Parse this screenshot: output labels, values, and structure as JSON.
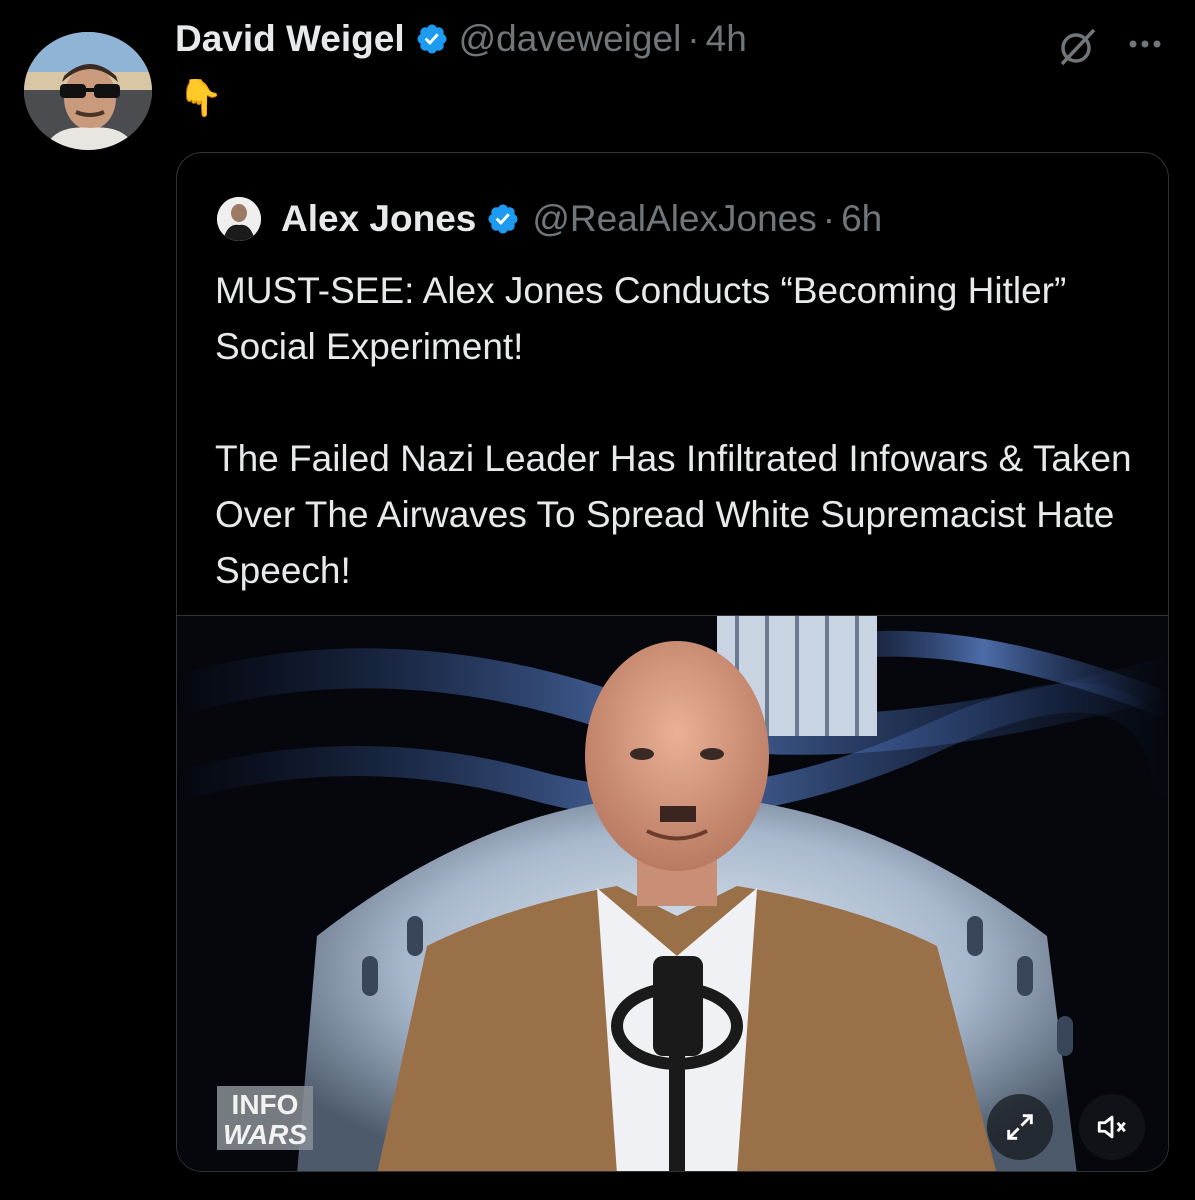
{
  "author": {
    "name": "David Weigel",
    "handle": "@daveweigel",
    "separator": "·",
    "time": "4h",
    "text": "👇"
  },
  "icons": {
    "verified": "verified-badge-icon",
    "grok": "grok-icon",
    "more": "more-options-icon",
    "expand": "expand-icon",
    "mute": "muted-speaker-icon"
  },
  "colors": {
    "background": "#000000",
    "text": "#e7e9ea",
    "muted": "#71767b",
    "verified": "#1d9bf0",
    "border": "#2f3336"
  },
  "quoted": {
    "name": "Alex Jones",
    "handle": "@RealAlexJones",
    "separator": "·",
    "time": "6h",
    "paragraph1": "MUST-SEE: Alex Jones Conducts “Becoming Hitler” Social Experiment!",
    "paragraph2": "The Failed Nazi Leader Has Infiltrated Infowars & Taken Over The Airwaves To Spread White Supremacist Hate Speech!",
    "media": {
      "logo_line1": "INFO",
      "logo_line2": "WARS"
    }
  }
}
